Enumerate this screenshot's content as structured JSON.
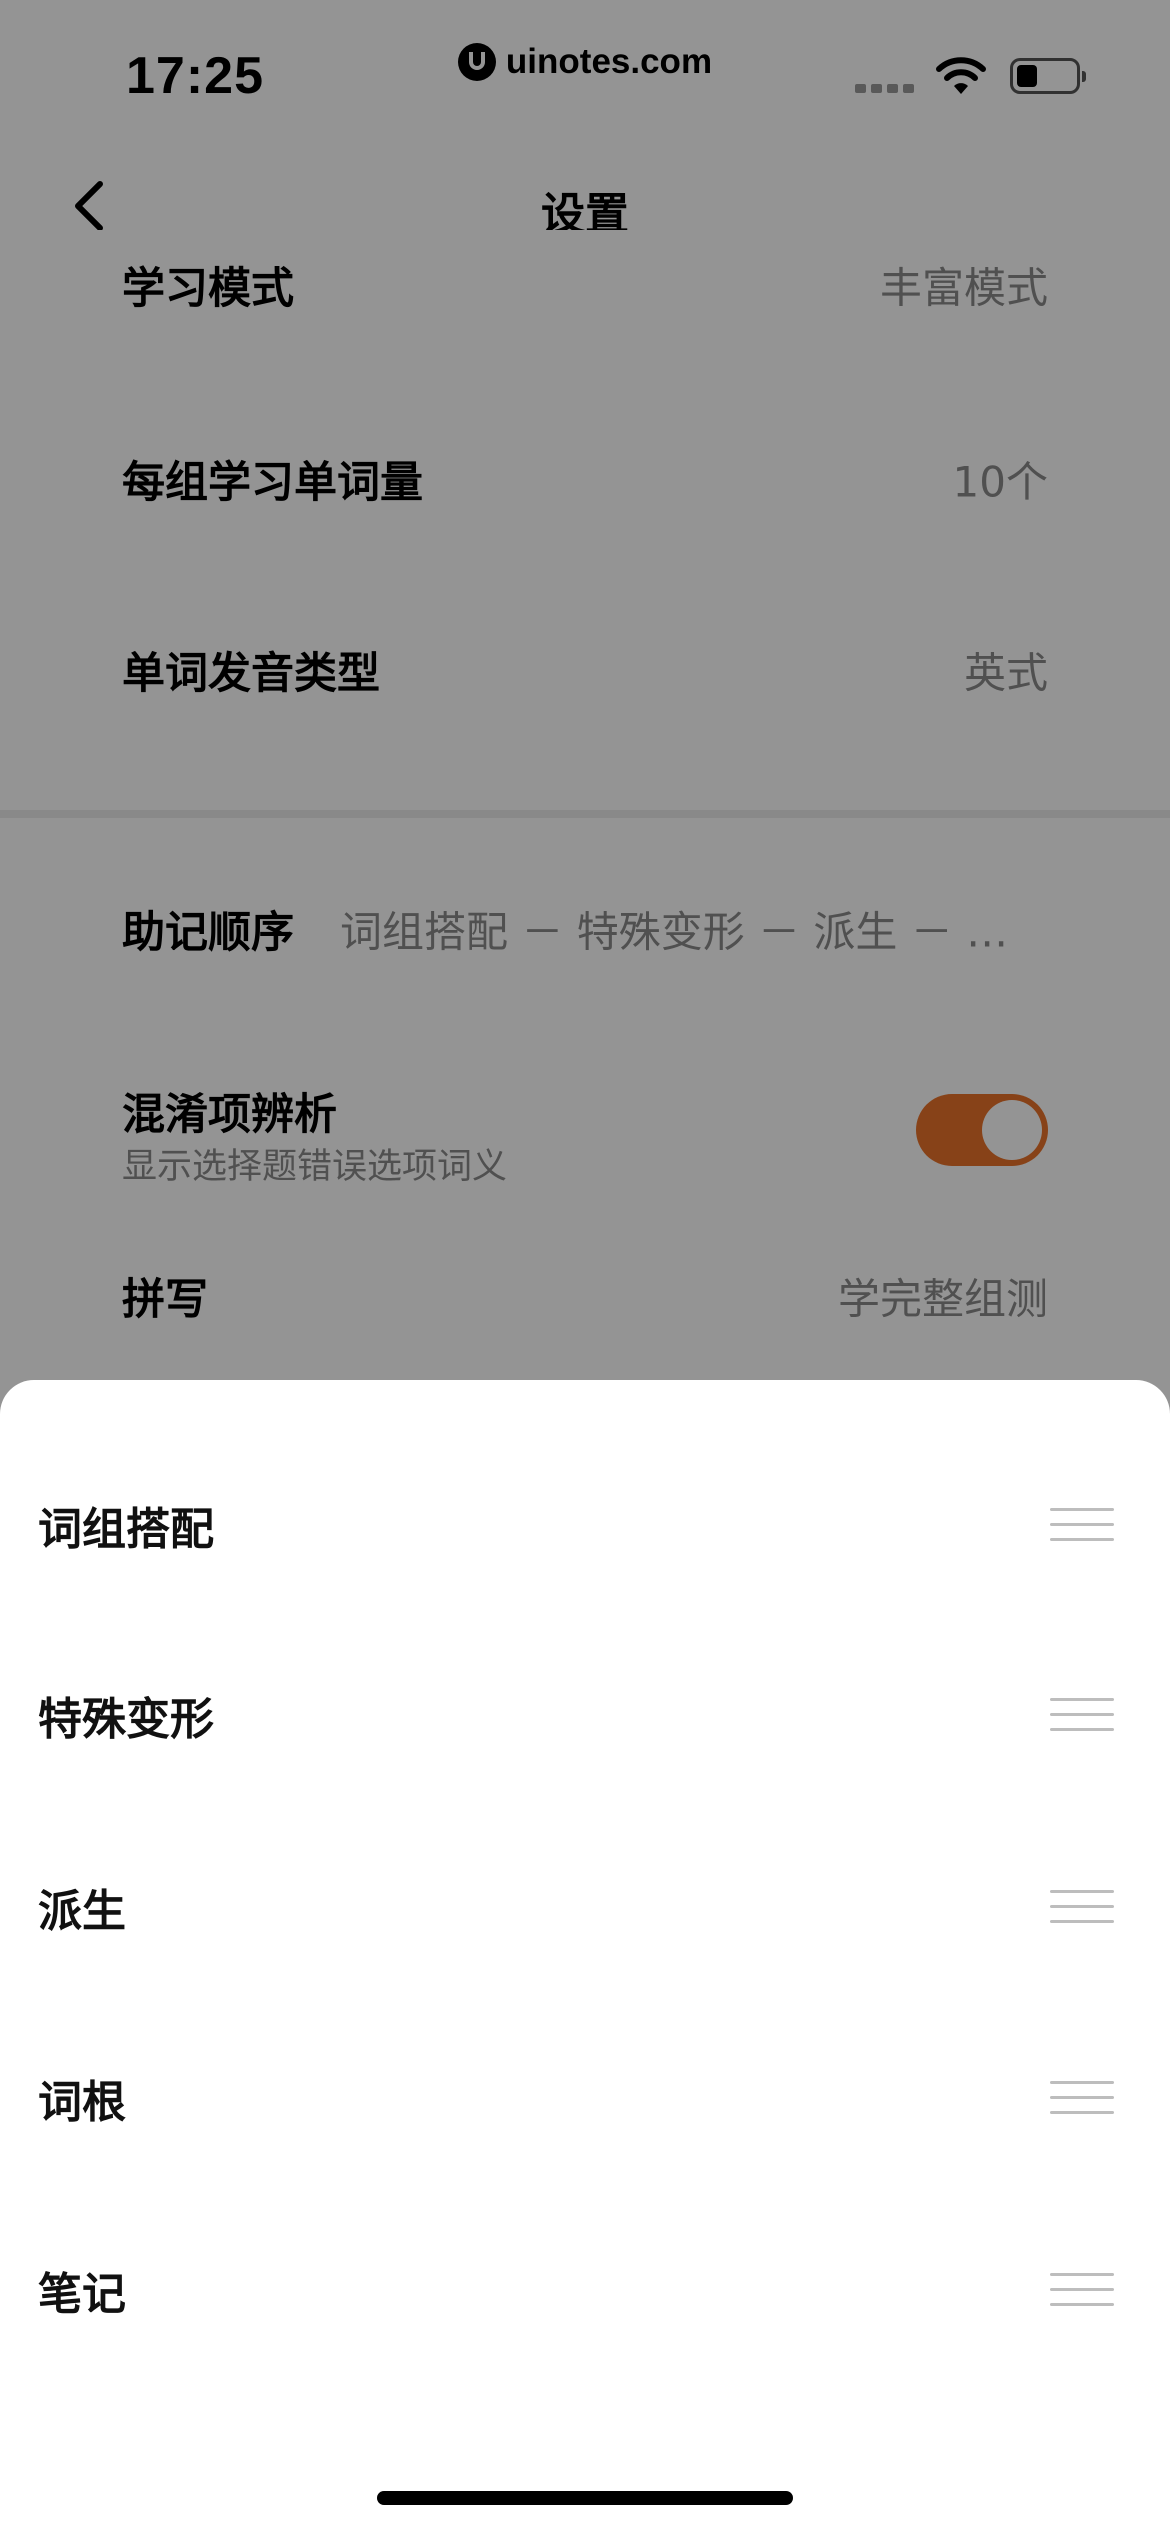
{
  "status_bar": {
    "time": "17:25",
    "watermark": "uinotes.com"
  },
  "nav": {
    "title": "设置"
  },
  "settings": {
    "study_mode": {
      "label": "学习模式",
      "value": "丰富模式"
    },
    "words_per_group": {
      "label": "每组学习单词量",
      "value": "10个"
    },
    "pronunciation": {
      "label": "单词发音类型",
      "value": "英式"
    },
    "mnemonic_order": {
      "label": "助记顺序",
      "value": "词组搭配 － 特殊变形 － 派生 － 词..."
    },
    "confusion_analysis": {
      "label": "混淆项辨析",
      "subtitle": "显示选择题错误选项词义",
      "enabled": true
    },
    "spelling": {
      "label": "拼写",
      "value": "学完整组测"
    }
  },
  "sheet": {
    "items": [
      {
        "label": "词组搭配"
      },
      {
        "label": "特殊变形"
      },
      {
        "label": "派生"
      },
      {
        "label": "词根"
      },
      {
        "label": "笔记"
      }
    ]
  },
  "colors": {
    "toggle_on": "#e8732a",
    "overlay": "rgba(0,0,0,0.42)",
    "secondary_text": "#8a8a8a"
  }
}
